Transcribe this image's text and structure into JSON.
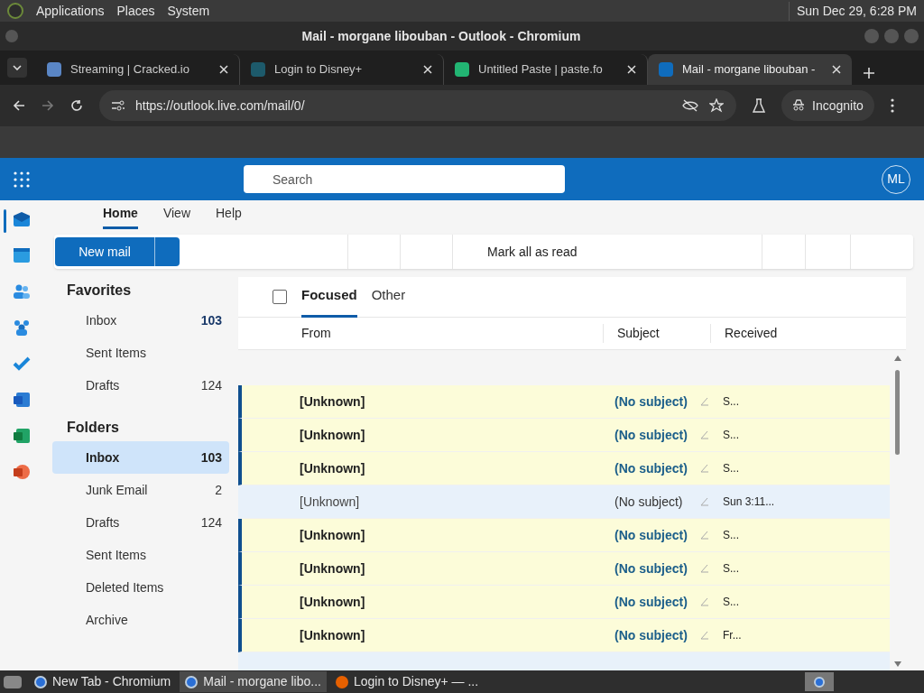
{
  "top_panel": {
    "menus": [
      "Applications",
      "Places",
      "System"
    ],
    "clock": "Sun Dec 29,  6:28 PM"
  },
  "window": {
    "title": "Mail - morgane libouban - Outlook - Chromium"
  },
  "browser_tabs": [
    {
      "title": "Streaming | Cracked.io",
      "selected": false
    },
    {
      "title": "Login to Disney+",
      "selected": false
    },
    {
      "title": "Untitled Paste | paste.fo",
      "selected": false
    },
    {
      "title": "Mail - morgane libouban -",
      "selected": true
    }
  ],
  "address_bar": {
    "url": "https://outlook.live.com/mail/0/",
    "profile": "Incognito"
  },
  "outlook_header": {
    "search": {
      "placeholder": "Search"
    },
    "avatar": "ML"
  },
  "ribbon_tabs": [
    {
      "label": "Home",
      "selected": true
    },
    {
      "label": "View",
      "selected": false
    },
    {
      "label": "Help",
      "selected": false
    }
  ],
  "ribbon": {
    "new_mail": "New mail",
    "mark_all_read": "Mark all as read"
  },
  "favorites": {
    "title": "Favorites",
    "items": [
      {
        "label": "Inbox",
        "count": "103",
        "selected": false
      },
      {
        "label": "Sent Items",
        "selected": false
      },
      {
        "label": "Drafts",
        "count": "124",
        "selected": false
      }
    ]
  },
  "folders": {
    "title": "Folders",
    "items": [
      {
        "label": "Inbox",
        "count": "103",
        "selected": true
      },
      {
        "label": "Junk Email",
        "count": "2",
        "selected": false
      },
      {
        "label": "Drafts",
        "count": "124",
        "selected": false
      },
      {
        "label": "Sent Items",
        "selected": false
      },
      {
        "label": "Deleted Items",
        "selected": false
      },
      {
        "label": "Archive",
        "selected": false
      }
    ]
  },
  "select_all": {
    "checked": false
  },
  "inbox_tabs": [
    {
      "label": "Focused",
      "selected": true
    },
    {
      "label": "Other",
      "selected": false
    }
  ],
  "columns": [
    "From",
    "Subject",
    "Received"
  ],
  "messages": [
    {
      "from": "[Unknown]",
      "subject": "(No subject)",
      "received": "S...",
      "unread": true
    },
    {
      "from": "[Unknown]",
      "subject": "(No subject)",
      "received": "S...",
      "unread": true
    },
    {
      "from": "[Unknown]",
      "subject": "(No subject)",
      "received": "S...",
      "unread": true
    },
    {
      "from": "[Unknown]",
      "subject": "(No subject)",
      "received": "Sun 3:11...",
      "unread": false
    },
    {
      "from": "[Unknown]",
      "subject": "(No subject)",
      "received": "S...",
      "unread": true
    },
    {
      "from": "[Unknown]",
      "subject": "(No subject)",
      "received": "S...",
      "unread": true
    },
    {
      "from": "[Unknown]",
      "subject": "(No subject)",
      "received": "S...",
      "unread": true
    },
    {
      "from": "[Unknown]",
      "subject": "(No subject)",
      "received": "Fr...",
      "unread": true
    }
  ],
  "taskbar": [
    {
      "title": "New Tab - Chromium",
      "selected": false
    },
    {
      "title": "Mail - morgane libo...",
      "selected": true
    },
    {
      "title": "Login to Disney+ — ...",
      "selected": false
    }
  ]
}
